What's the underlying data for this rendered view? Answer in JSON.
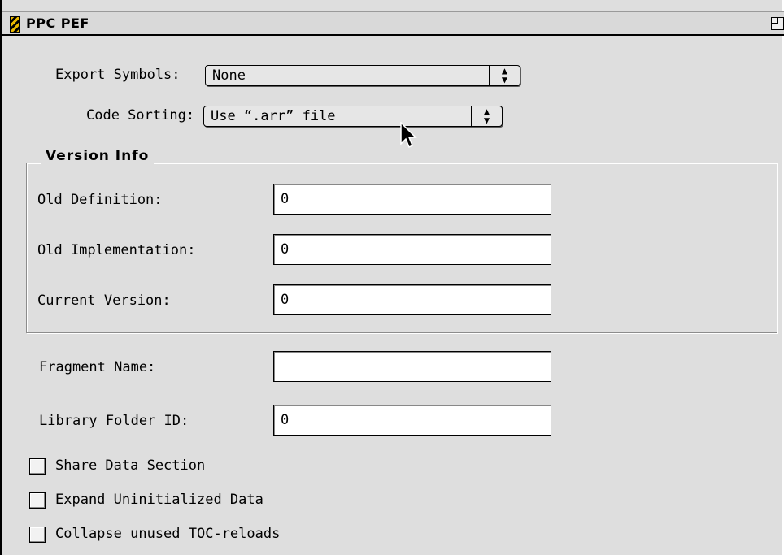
{
  "window": {
    "title": "PPC PEF"
  },
  "export_symbols": {
    "label": "Export Symbols:",
    "value": "None"
  },
  "code_sorting": {
    "label": "Code Sorting:",
    "value": "Use “.arr” file"
  },
  "version_info": {
    "title": "Version Info",
    "old_definition": {
      "label": "Old Definition:",
      "value": "0"
    },
    "old_implementation": {
      "label": "Old Implementation:",
      "value": "0"
    },
    "current_version": {
      "label": "Current Version:",
      "value": "0"
    }
  },
  "fragment_name": {
    "label": "Fragment Name:",
    "value": ""
  },
  "library_folder_id": {
    "label": "Library Folder ID:",
    "value": "0"
  },
  "checkboxes": [
    {
      "label": "Share Data Section",
      "checked": false
    },
    {
      "label": "Expand Uninitialized Data",
      "checked": false
    },
    {
      "label": "Collapse unused TOC-reloads",
      "checked": false
    }
  ],
  "icons": {
    "title_icon": "striped-panel-icon",
    "zoom": "zoom-box-icon",
    "popup_arrows": "up-down-arrows-icon",
    "cursor": "arrow-cursor-icon"
  }
}
